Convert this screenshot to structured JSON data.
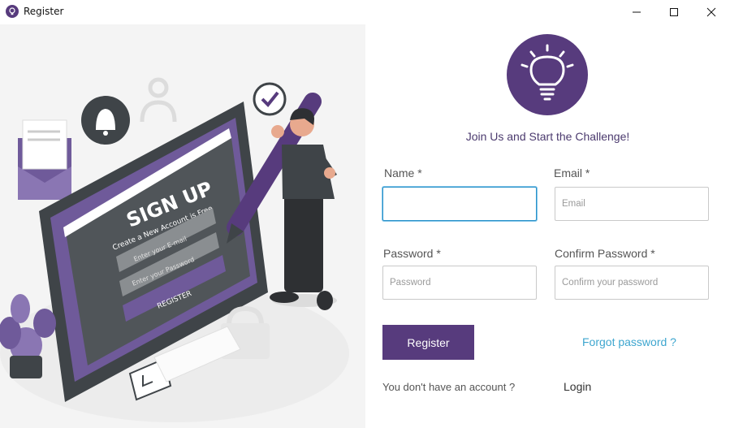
{
  "window": {
    "title": "Register",
    "icon": "lightbulb-app-icon",
    "controls": [
      "minimize-icon",
      "maximize-icon",
      "close-icon"
    ]
  },
  "illustration": {
    "heading": "SIGN UP",
    "tagline": "Create a New Account is Free",
    "email_placeholder": "Enter your E-mail",
    "password_placeholder": "Enter your Password",
    "button": "REGISTER"
  },
  "header": {
    "logo_icon": "lightbulb-icon",
    "subtitle": "Join Us and Start the Challenge!"
  },
  "form": {
    "name": {
      "label": "Name *",
      "value": "",
      "placeholder": ""
    },
    "email": {
      "label": "Email *",
      "value": "",
      "placeholder": "Email"
    },
    "password": {
      "label": "Password *",
      "value": "",
      "placeholder": "Password"
    },
    "confirm_password": {
      "label": "Confirm Password *",
      "value": "",
      "placeholder": "Confirm your password"
    }
  },
  "actions": {
    "register_label": "Register",
    "forgot_label": "Forgot password ?",
    "no_account_text": "You don't have an account ?",
    "login_label": "Login"
  },
  "colors": {
    "brand": "#573b7d",
    "link": "#3ea6cf",
    "focus": "#2a92c9"
  }
}
